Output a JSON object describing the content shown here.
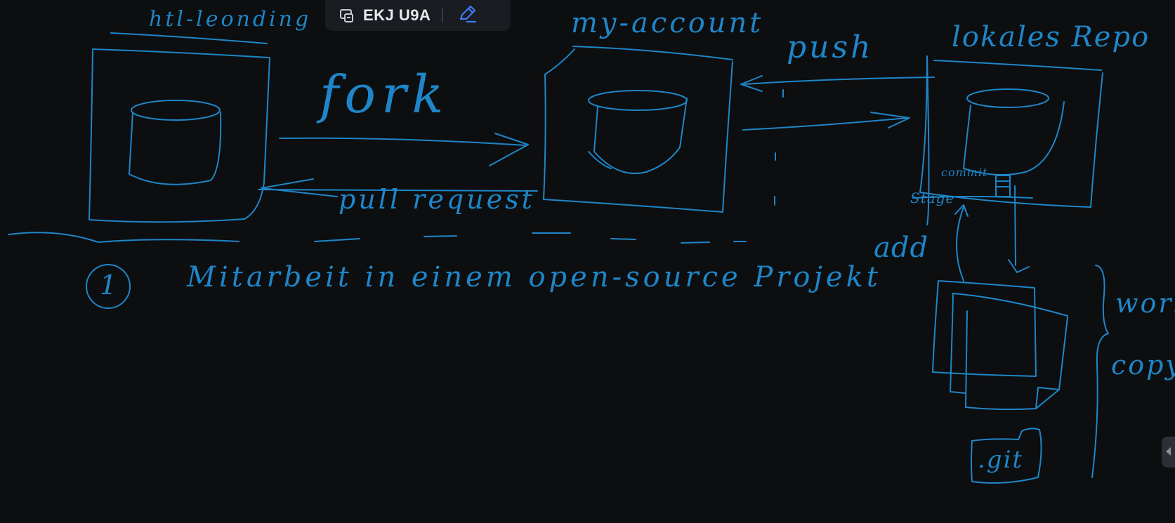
{
  "toolbar": {
    "board_icon": "whiteboard-icon",
    "title": "EKJ U9A",
    "edit_icon": "pen-icon"
  },
  "side_panel": {
    "toggle_icon": "chevron-left-icon"
  },
  "handwriting": {
    "top_left_label": "htl-leonding",
    "top_mid_label": "my-account",
    "top_right_label": "lokales Repo",
    "fork_label": "fork",
    "pull_request_label": "pull request",
    "push_label": "push",
    "commit_label": "commit",
    "stage_label": "Stage",
    "add_label": "add",
    "item_number": "1",
    "caption": "Mitarbeit in einem open-source Projekt",
    "working_copy_line1": "work",
    "working_copy_line2": "copy",
    "git_folder_label": ".git"
  },
  "colors": {
    "background": "#0d0e10",
    "ink": "#1e86c8",
    "toolbar_bg": "#1a1c22",
    "accent": "#3d7bf0"
  }
}
